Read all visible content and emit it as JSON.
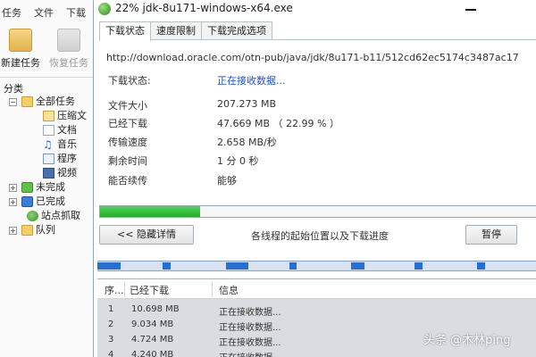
{
  "bg_window": {
    "menu": [
      "任务",
      "文件",
      "下载"
    ],
    "toolbar": {
      "new_task": "新建任务",
      "restore_task": "恢复任务"
    },
    "category_title": "分类",
    "tree": [
      {
        "label": "全部任务",
        "expander": "−",
        "icon": "folder-icon"
      },
      {
        "label": "压缩文",
        "icon": "zip-icon"
      },
      {
        "label": "文档",
        "icon": "document-icon"
      },
      {
        "label": "音乐",
        "icon": "music-icon",
        "glyph": "♫"
      },
      {
        "label": "程序",
        "icon": "program-icon"
      },
      {
        "label": "视频",
        "icon": "video-icon"
      },
      {
        "label": "未完成",
        "expander": "+",
        "icon": "download-arrow-icon"
      },
      {
        "label": "已完成",
        "expander": "+",
        "icon": "checkmark-icon"
      },
      {
        "label": "站点抓取",
        "icon": "globe-icon"
      },
      {
        "label": "队列",
        "expander": "+",
        "icon": "queue-folder-icon"
      }
    ]
  },
  "dialog": {
    "title": "22% jdk-8u171-windows-x64.exe",
    "tabs": [
      "下载状态",
      "速度限制",
      "下载完成选项"
    ],
    "url": "http://download.oracle.com/otn-pub/java/jdk/8u171-b11/512cd62ec5174c3487ac17",
    "status_label": "下载状态:",
    "status_value": "正在接收数据...",
    "info": [
      {
        "label": "文件大小",
        "value": "207.273  MB"
      },
      {
        "label": "已经下载",
        "value": "47.669  MB  （ 22.99 % ）"
      },
      {
        "label": "传输速度",
        "value": "2.658  MB/秒"
      },
      {
        "label": "剩余时间",
        "value": "1 分 0 秒"
      },
      {
        "label": "能否续传",
        "value": "能够"
      }
    ],
    "progress_fraction": 0.2299,
    "hide_details_button": "<< 隐藏详情",
    "threads_label": "各线程的起始位置以及下载进度",
    "pause_button": "暂停",
    "thread_segments": [
      {
        "start": 0.0,
        "fraction": 0.052
      },
      {
        "start": 0.149,
        "fraction": 0.018
      },
      {
        "start": 0.292,
        "fraction": 0.052
      },
      {
        "start": 0.438,
        "fraction": 0.016
      },
      {
        "start": 0.578,
        "fraction": 0.03
      },
      {
        "start": 0.722,
        "fraction": 0.018
      },
      {
        "start": 0.864,
        "fraction": 0.018
      }
    ],
    "table": {
      "headers": [
        "序...",
        "已经下载",
        "信息"
      ],
      "rows": [
        {
          "seq": "1",
          "downloaded": "10.698  MB",
          "info": "正在接收数据..."
        },
        {
          "seq": "2",
          "downloaded": "9.034  MB",
          "info": "正在接收数据..."
        },
        {
          "seq": "3",
          "downloaded": "4.724  MB",
          "info": "正在接收数据..."
        },
        {
          "seq": "4",
          "downloaded": "4.240  MB",
          "info": "正在接收数据..."
        }
      ]
    }
  },
  "watermark": "头条 @木林ping"
}
